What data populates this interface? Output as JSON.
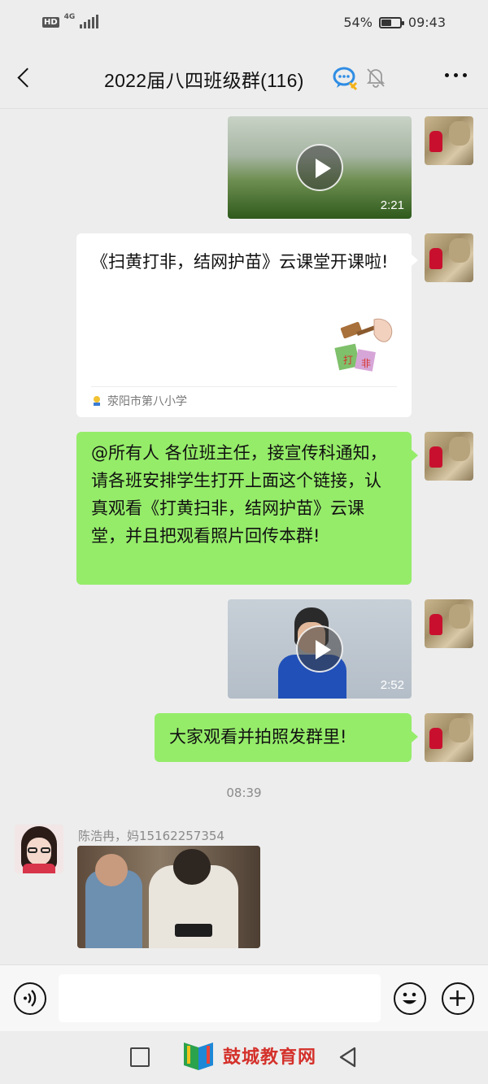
{
  "status_bar": {
    "hd": "HD",
    "network": "4G",
    "battery_text": "54%",
    "battery_level": 0.54,
    "time": "09:43"
  },
  "nav": {
    "title": "2022届八四班级群(116)",
    "icons": [
      "back-arrow-icon",
      "chat-bubble-icon",
      "mute-bell-icon",
      "more-icon"
    ]
  },
  "messages": {
    "video1": {
      "duration": "2:21"
    },
    "link_card": {
      "title": "《扫黄打非，结网护苗》云课堂开课啦!",
      "source": "荥阳市第八小学"
    },
    "text1": "@所有人  各位班主任，接宣传科通知，请各班安排学生打开上面这个链接，认真观看《打黄扫非，结网护苗》云课堂，并且把观看照片回传本群!",
    "video2": {
      "duration": "2:52"
    },
    "text2": "大家观看并拍照发群里!",
    "timestamp": "08:39",
    "photo_sender": "陈浩冉，妈15162257354"
  },
  "input_bar": {
    "placeholder": "",
    "icons": [
      "voice-icon",
      "emoji-icon",
      "plus-icon"
    ]
  },
  "system_nav": {
    "watermark": "鼓城教育网",
    "icons": [
      "recent-apps-icon",
      "home-icon",
      "back-triangle-icon"
    ]
  },
  "colors": {
    "bubble_green": "#95ec69",
    "background": "#ededed",
    "watermark_red": "#d4312b"
  }
}
